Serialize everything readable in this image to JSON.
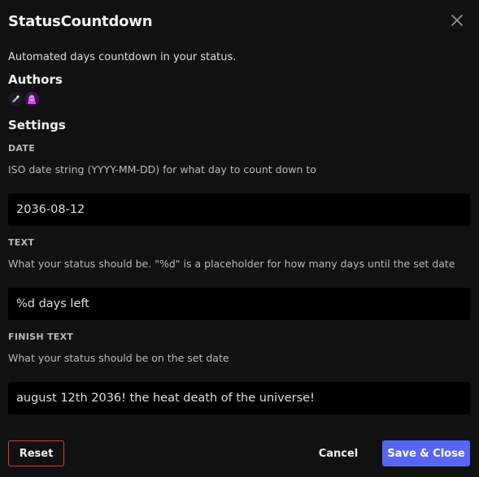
{
  "modal": {
    "title": "StatusCountdown",
    "description": "Automated days countdown in your status.",
    "authors_heading": "Authors",
    "authors": [
      {
        "avatar_icon": "author-avatar-icon",
        "colors": [
          "#1a1a22",
          "#c0c0d0"
        ]
      },
      {
        "avatar_icon": "author-avatar-icon",
        "colors": [
          "#5a1a7a",
          "#d050e0"
        ]
      }
    ],
    "settings_heading": "Settings"
  },
  "settings": {
    "date": {
      "label": "DATE",
      "note": "ISO date string (YYYY-MM-DD) for what day to count down to",
      "value": "2036-08-12"
    },
    "text": {
      "label": "TEXT",
      "note": "What your status should be. \"%d\" is a placeholder for how many days until the set date",
      "value": "%d days left"
    },
    "finish_text": {
      "label": "FINISH TEXT",
      "note": "What your status should be on the set date",
      "value": "august 12th 2036! the heat death of the universe!"
    }
  },
  "footer": {
    "reset_label": "Reset",
    "cancel_label": "Cancel",
    "save_label": "Save & Close"
  },
  "colors": {
    "background": "#111111",
    "input_background": "#000000",
    "accent": "#5865f2",
    "danger": "#da373c"
  }
}
